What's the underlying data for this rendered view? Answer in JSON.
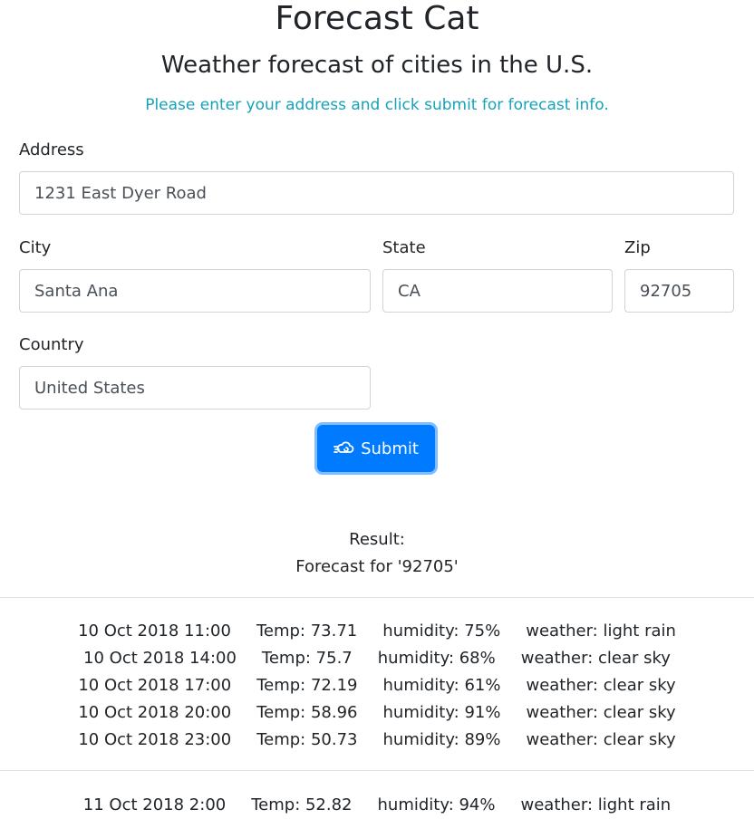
{
  "header": {
    "title": "Forecast Cat",
    "subtitle": "Weather forecast of cities in the U.S.",
    "intro": "Please enter your address and click submit for forecast info."
  },
  "form": {
    "address": {
      "label": "Address",
      "value": "1231 East Dyer Road"
    },
    "city": {
      "label": "City",
      "value": "Santa Ana"
    },
    "state": {
      "label": "State",
      "value": "CA"
    },
    "zip": {
      "label": "Zip",
      "value": "92705"
    },
    "country": {
      "label": "Country",
      "value": "United States"
    },
    "submit_label": "Submit",
    "submit_icon": "cloud-wind-icon",
    "accent_color": "#007bff"
  },
  "result": {
    "label": "Result:",
    "query": "Forecast for '92705'",
    "groups": [
      {
        "rows": [
          {
            "datetime": "10 Oct 2018 11:00",
            "temp": "Temp: 73.71",
            "humidity": "humidity: 75%",
            "weather": "weather: light rain"
          },
          {
            "datetime": "10 Oct 2018 14:00",
            "temp": "Temp: 75.7",
            "humidity": "humidity: 68%",
            "weather": "weather: clear sky"
          },
          {
            "datetime": "10 Oct 2018 17:00",
            "temp": "Temp: 72.19",
            "humidity": "humidity: 61%",
            "weather": "weather: clear sky"
          },
          {
            "datetime": "10 Oct 2018 20:00",
            "temp": "Temp: 58.96",
            "humidity": "humidity: 91%",
            "weather": "weather: clear sky"
          },
          {
            "datetime": "10 Oct 2018 23:00",
            "temp": "Temp: 50.73",
            "humidity": "humidity: 89%",
            "weather": "weather: clear sky"
          }
        ]
      },
      {
        "rows": [
          {
            "datetime": "11 Oct 2018 2:00",
            "temp": "Temp: 52.82",
            "humidity": "humidity: 94%",
            "weather": "weather: light rain"
          }
        ]
      }
    ]
  }
}
